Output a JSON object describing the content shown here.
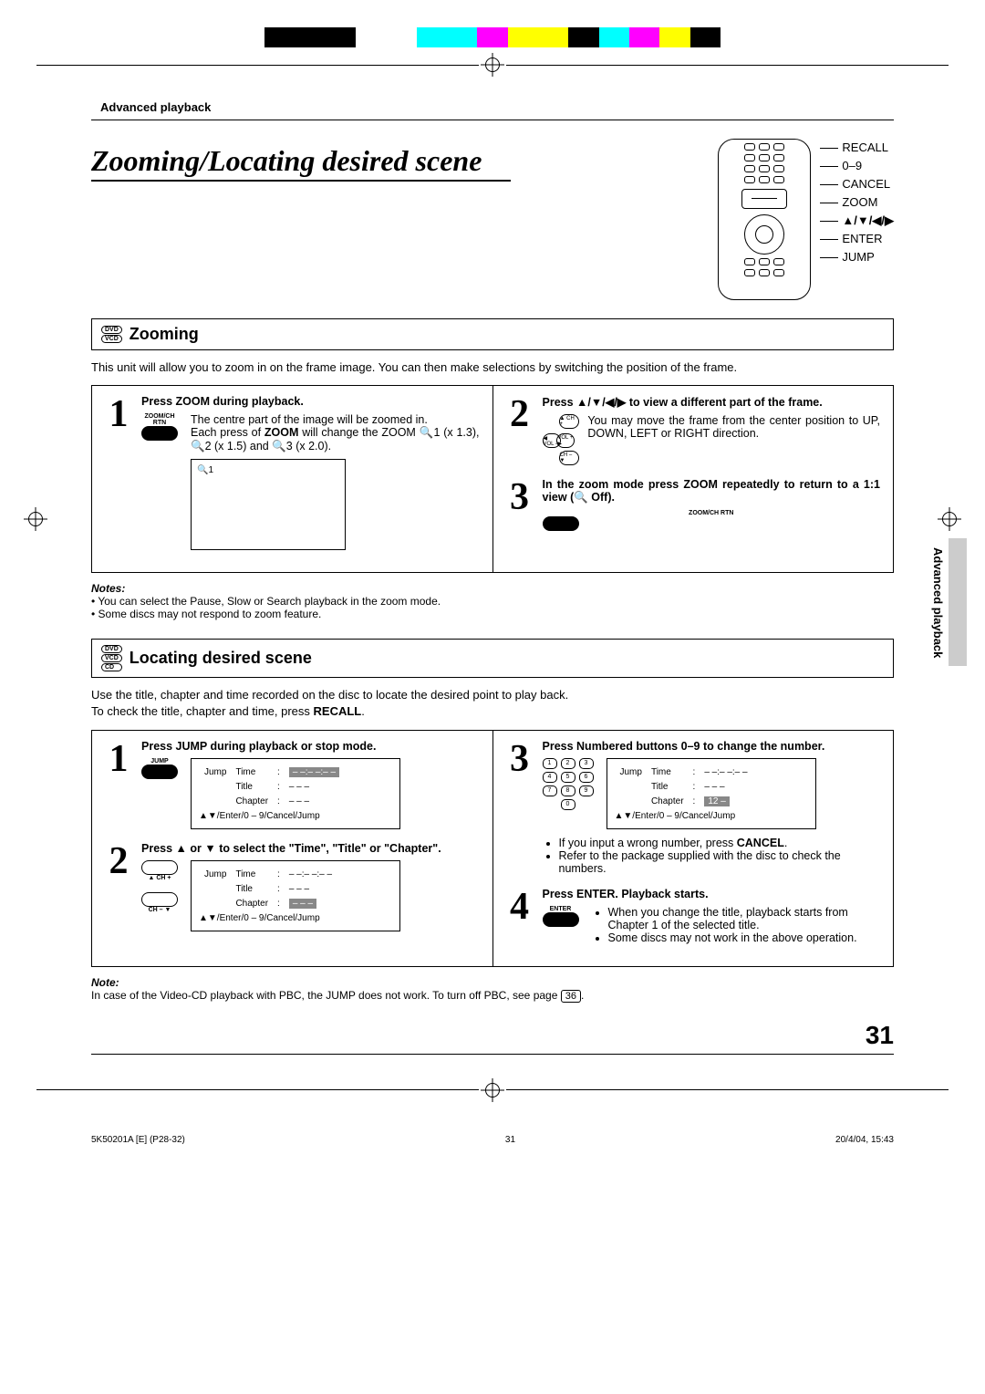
{
  "header": {
    "category": "Advanced playback"
  },
  "title": "Zooming/Locating desired scene",
  "remote_labels": [
    "RECALL",
    "0–9",
    "CANCEL",
    "ZOOM",
    "▲/▼/◀/▶",
    "ENTER",
    "JUMP"
  ],
  "side_tab": "Advanced playback",
  "section_zoom": {
    "badges": [
      "DVD",
      "VCD"
    ],
    "heading": "Zooming",
    "intro": "This unit will allow you to zoom in on the frame image. You can then make selections by switching the position of the frame.",
    "step1": {
      "head": "Press ZOOM during playback.",
      "btn_label": "ZOOM/CH RTN",
      "body1": "The centre part of the image will be zoomed in.",
      "body2_a": "Each press of ",
      "body2_b": "ZOOM",
      "body2_c": " will change the ZOOM 🔍1 (x 1.3), 🔍2 (x 1.5) and 🔍3 (x 2.0).",
      "screen": "🔍1"
    },
    "step2": {
      "head": "Press ▲/▼/◀/▶ to view a different part of the frame.",
      "body": "You may move the frame from the center position to UP, DOWN, LEFT or RIGHT direction.",
      "dpad": {
        "up": "▲ CH +",
        "dn": "CH – ▼",
        "lf": "◀ VOL –",
        "rt": "VOL + ▶"
      }
    },
    "step3": {
      "head": "In the zoom mode press ZOOM repeatedly to return to a 1:1 view (🔍 Off).",
      "btn_label": "ZOOM/CH RTN"
    },
    "notes_head": "Notes:",
    "notes": [
      "You can select the Pause, Slow or Search playback in the zoom mode.",
      "Some discs may not respond to zoom feature."
    ]
  },
  "section_locate": {
    "badges": [
      "DVD",
      "VCD",
      "CD"
    ],
    "heading": "Locating desired scene",
    "intro1": "Use the title, chapter and time recorded on the disc to locate the desired point to play back.",
    "intro2_a": "To check the title, chapter and time, press ",
    "intro2_b": "RECALL",
    "intro2_c": ".",
    "step1": {
      "head": "Press JUMP during playback or stop mode.",
      "btn_label": "JUMP",
      "screen": {
        "jump": "Jump",
        "time_k": "Time",
        "time_v": "– –:– –:– –",
        "title_k": "Title",
        "title_v": "– – –",
        "chap_k": "Chapter",
        "chap_v": "– – –",
        "hint": "▲▼/Enter/0 – 9/Cancel/Jump"
      }
    },
    "step2": {
      "head": "Press ▲ or ▼ to select the \"Time\", \"Title\" or \"Chapter\".",
      "btn_up": "▲ CH +",
      "btn_dn": "CH – ▼",
      "screen": {
        "jump": "Jump",
        "time_k": "Time",
        "time_v": "– –:– –:– –",
        "title_k": "Title",
        "title_v": "– – –",
        "chap_k": "Chapter",
        "chap_v": "– – –",
        "hint": "▲▼/Enter/0 – 9/Cancel/Jump"
      }
    },
    "step3": {
      "head": "Press Numbered buttons 0–9 to change the number.",
      "screen": {
        "jump": "Jump",
        "time_k": "Time",
        "time_v": "– –:– –:– –",
        "title_k": "Title",
        "title_v": "– – –",
        "chap_k": "Chapter",
        "chap_v": "12 –",
        "hint": "▲▼/Enter/0 – 9/Cancel/Jump"
      },
      "bullet1_a": "If you input a wrong number, press ",
      "bullet1_b": "CANCEL",
      "bullet1_c": ".",
      "bullet2": "Refer to the package supplied with the disc to check the numbers."
    },
    "step4": {
      "head": "Press ENTER. Playback starts.",
      "btn_label": "ENTER",
      "bullet1": "When you change the title, playback starts from Chapter 1 of the selected title.",
      "bullet2": "Some discs may not work in the above operation."
    },
    "note_head": "Note:",
    "note_a": "In case of the Video-CD playback with PBC, the JUMP does not work. To turn off PBC, see page ",
    "note_page": "36",
    "note_b": "."
  },
  "page_number": "31",
  "footer": {
    "left": "5K50201A [E] (P28-32)",
    "center": "31",
    "right": "20/4/04, 15:43"
  }
}
